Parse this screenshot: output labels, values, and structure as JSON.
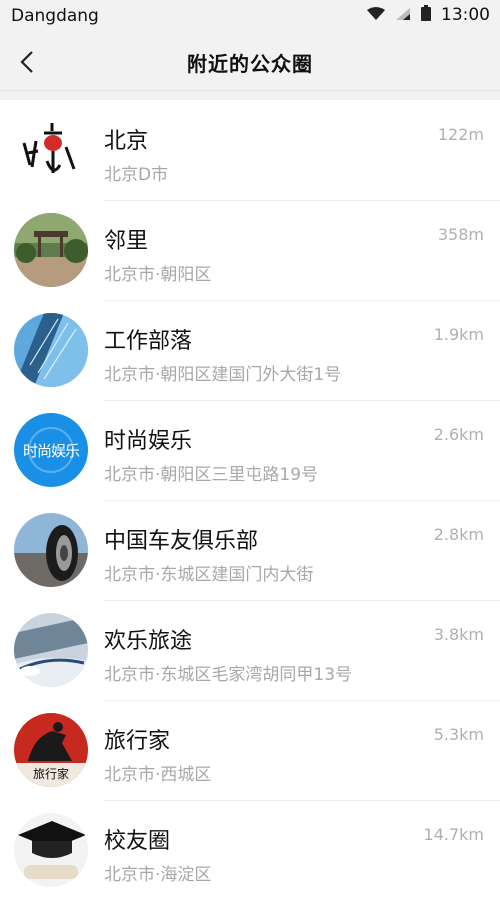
{
  "status_bar": {
    "carrier": "Dangdang",
    "time": "13:00"
  },
  "nav": {
    "title": "附近的公众圈"
  },
  "items": [
    {
      "name": "北京",
      "address": "北京D市",
      "distance": "122m",
      "icon": "beijing-logo-icon"
    },
    {
      "name": "邻里",
      "address": "北京市·朝阳区",
      "distance": "358m",
      "icon": "park-photo-icon"
    },
    {
      "name": "工作部落",
      "address": "北京市·朝阳区建国门外大街1号",
      "distance": "1.9km",
      "icon": "skyscraper-icon"
    },
    {
      "name": "时尚娱乐",
      "address": "北京市·朝阳区三里屯路19号",
      "distance": "2.6km",
      "icon": "fashion-logo-icon"
    },
    {
      "name": "中国车友俱乐部",
      "address": "北京市·东城区建国门内大街",
      "distance": "2.8km",
      "icon": "car-wheel-icon"
    },
    {
      "name": "欢乐旅途",
      "address": "北京市·东城区毛家湾胡同甲13号",
      "distance": "3.8km",
      "icon": "train-icon"
    },
    {
      "name": "旅行家",
      "address": "北京市·西城区",
      "distance": "5.3km",
      "icon": "traveler-icon"
    },
    {
      "name": "校友圈",
      "address": "北京市·海淀区",
      "distance": "14.7km",
      "icon": "graduation-cap-icon"
    }
  ],
  "avatar_texts": {
    "fashion": "时尚娱乐",
    "traveler": "旅行家"
  },
  "colors": {
    "background": "#f2f2f2",
    "secondary_text": "#a8a8a8",
    "accent_blue": "#1a8fe6"
  }
}
